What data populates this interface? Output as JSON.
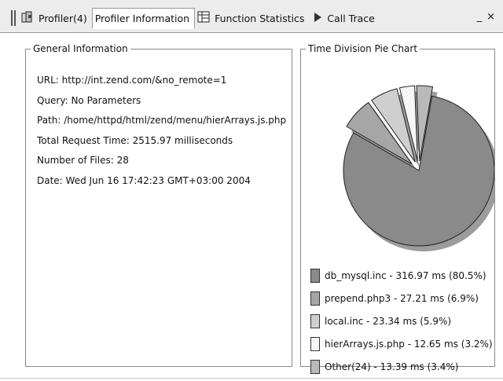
{
  "tabs": [
    {
      "label": "Profiler(4)",
      "icon": "profiler-icon",
      "active": false
    },
    {
      "label": "Profiler Information",
      "icon": "",
      "active": true
    },
    {
      "label": "Function Statistics",
      "icon": "table-icon",
      "active": false
    },
    {
      "label": "Call Trace",
      "icon": "play-arrow-icon",
      "active": false
    }
  ],
  "window_controls": {
    "minimize": "_",
    "close": "×"
  },
  "general": {
    "legend": "General Information",
    "items": [
      "URL: http://int.zend.com/&no_remote=1",
      "Query: No Parameters",
      "Path: /home/httpd/html/zend/menu/hierArrays.js.php",
      "Total Request Time: 2515.97 milliseconds",
      "Number of Files: 28",
      "Date: Wed Jun 16 17:42:23 GMT+03:00 2004"
    ]
  },
  "pie_panel": {
    "legend": "Time Division Pie Chart"
  },
  "chart_data": {
    "type": "pie",
    "title": "Time Division Pie Chart",
    "unit": "ms",
    "slices": [
      {
        "name": "db_mysql.inc",
        "value": 316.97,
        "percent": 80.5,
        "color": "#8a8a8a",
        "label": "db_mysql.inc - 316.97 ms (80.5%)"
      },
      {
        "name": "prepend.php3",
        "value": 27.21,
        "percent": 6.9,
        "color": "#a6a6a6",
        "label": "prepend.php3 - 27.21 ms (6.9%)"
      },
      {
        "name": "local.inc",
        "value": 23.34,
        "percent": 5.9,
        "color": "#cfcfcf",
        "label": "local.inc - 23.34 ms (5.9%)"
      },
      {
        "name": "hierArrays.js.php",
        "value": 12.65,
        "percent": 3.2,
        "color": "#f6f6f6",
        "label": "hierArrays.js.php - 12.65 ms (3.2%)"
      },
      {
        "name": "Other(24)",
        "value": 13.39,
        "percent": 3.4,
        "color": "#b9b9b9",
        "label": "Other(24) - 13.39 ms (3.4%)"
      }
    ]
  }
}
